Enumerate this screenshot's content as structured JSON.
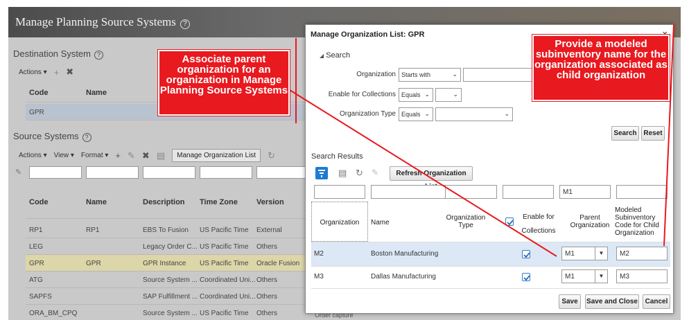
{
  "page": {
    "title": "Manage Planning Source Systems",
    "destination_title": "Destination System",
    "dest_actions": "Actions",
    "dest_cols": [
      "Code",
      "Name"
    ],
    "dest_row": "GPR",
    "source_title": "Source Systems",
    "source_toolbar": {
      "actions": "Actions",
      "view": "View",
      "format": "Format",
      "manage_btn": "Manage Organization List"
    },
    "source_cols": [
      "Code",
      "Name",
      "Description",
      "Time Zone",
      "Version"
    ],
    "source_rows": [
      {
        "code": "RP1",
        "name": "RP1",
        "description": "EBS To Fusion",
        "tz": "US Pacific Time",
        "version": "External"
      },
      {
        "code": "LEG",
        "name": "",
        "description": "Legacy Order C...",
        "tz": "US Pacific Time",
        "version": "Others"
      },
      {
        "code": "GPR",
        "name": "GPR",
        "description": "GPR Instance",
        "tz": "US Pacific Time",
        "version": "Oracle Fusion"
      },
      {
        "code": "ATG",
        "name": "",
        "description": "Source System ...",
        "tz": "Coordinated Uni...",
        "version": "Others"
      },
      {
        "code": "SAPFS",
        "name": "",
        "description": "SAP Fulfillment ...",
        "tz": "Coordinated Uni...",
        "version": "Others"
      },
      {
        "code": "ORA_BM_CPQ",
        "name": "",
        "description": "Source System ...",
        "tz": "US Pacific Time",
        "version": "Others"
      }
    ],
    "order_capture": "Order capture"
  },
  "dialog": {
    "title": "Manage Organization List: GPR",
    "close": "×",
    "search_label": "Search",
    "org_label": "Organization",
    "org_op": "Starts with",
    "enable_label": "Enable for Collections",
    "enable_op": "Equals",
    "orgtype_label": "Organization Type",
    "orgtype_op": "Equals",
    "search_btn": "Search",
    "reset_btn": "Reset",
    "results_title": "Search Results",
    "refresh_btn": "Refresh Organization List",
    "filter_parent": "M1",
    "cols": {
      "organization": "Organization",
      "name": "Name",
      "org_type": "Organization Type",
      "enable": "Enable for Collections",
      "parent": "Parent Organization",
      "subinv": "Modeled Subinventory Code for Child Organization"
    },
    "rows": [
      {
        "org": "M2",
        "name": "Boston Manufacturing",
        "enabled": true,
        "parent": "M1",
        "subinv": "M2"
      },
      {
        "org": "M3",
        "name": "Dallas Manufacturing",
        "enabled": true,
        "parent": "M1",
        "subinv": "M3"
      }
    ],
    "save_btn": "Save",
    "save_close_btn": "Save and Close",
    "cancel_btn": "Cancel"
  },
  "callouts": {
    "left": "Associate parent organization for an organization in Manage Planning Source Systems",
    "right": "Provide a modeled subinventory name for the organization associated as child organization"
  },
  "colors": {
    "callout": "#e8191f",
    "selected_row": "#dce8f5",
    "accent": "#1f7bd1"
  }
}
